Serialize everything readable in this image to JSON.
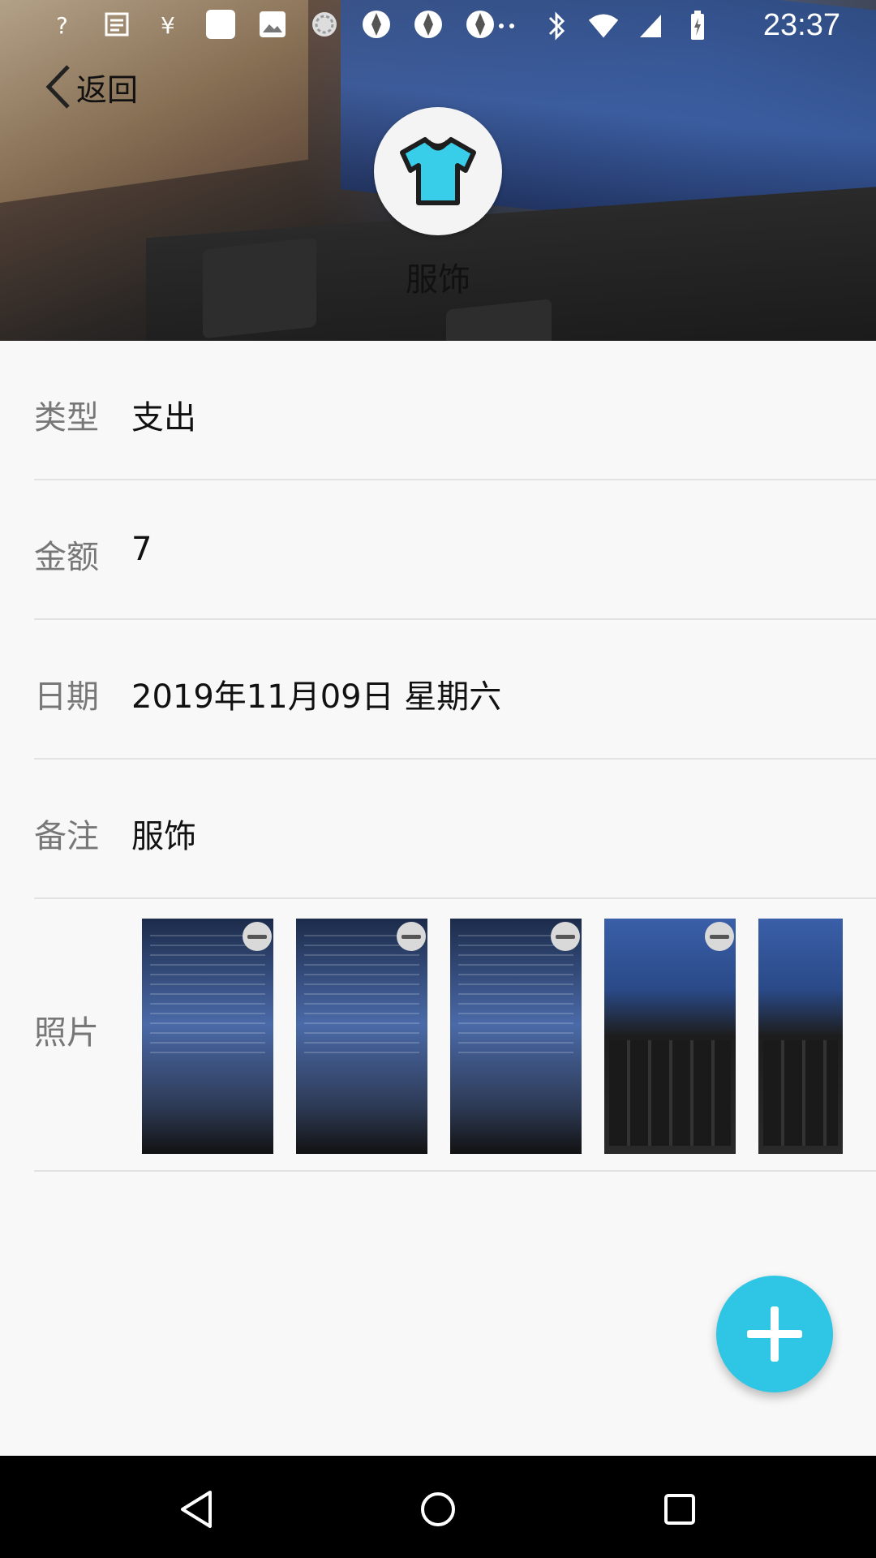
{
  "status_bar": {
    "time": "23:37"
  },
  "header": {
    "back_label": "返回",
    "category_icon": "tshirt-icon",
    "category_name": "服饰",
    "accent_color": "#2ec6e4"
  },
  "details": {
    "type": {
      "label": "类型",
      "value": "支出"
    },
    "amount": {
      "label": "金额",
      "value": "7"
    },
    "date": {
      "label": "日期",
      "value": "2019年11月09日 星期六"
    },
    "note": {
      "label": "备注",
      "value": "服饰"
    },
    "photos": {
      "label": "照片",
      "count": 5
    }
  },
  "fab": {
    "icon": "plus-icon"
  },
  "nav": {
    "back_icon": "nav-back-icon",
    "home_icon": "nav-home-icon",
    "recents_icon": "nav-recents-icon"
  }
}
